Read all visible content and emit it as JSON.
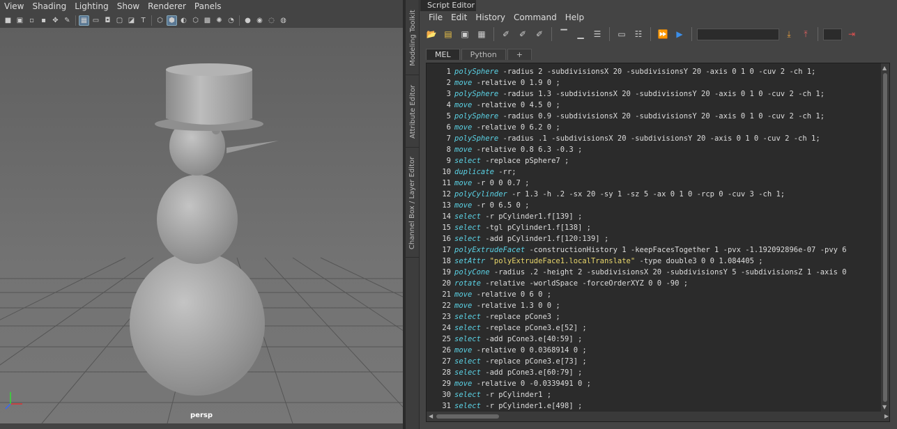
{
  "viewport": {
    "menus": [
      "View",
      "Shading",
      "Lighting",
      "Show",
      "Renderer",
      "Panels"
    ],
    "camera": "persp"
  },
  "side_tabs": [
    "Modeling Toolkit",
    "Attribute Editor",
    "Channel Box / Layer Editor"
  ],
  "script_editor": {
    "title": "Script Editor",
    "menus": [
      "File",
      "Edit",
      "History",
      "Command",
      "Help"
    ],
    "tabs": [
      "MEL",
      "Python",
      "+"
    ],
    "active_tab": "MEL",
    "lines": [
      [
        [
          "kw",
          "polySphere"
        ],
        [
          "t",
          " -radius 2 -subdivisionsX 20 -subdivisionsY 20 -axis 0 1 0 -cuv 2 -ch 1;"
        ]
      ],
      [
        [
          "kw",
          "move"
        ],
        [
          "t",
          " -relative 0 1.9 0 ;"
        ]
      ],
      [
        [
          "kw",
          "polySphere"
        ],
        [
          "t",
          " -radius 1.3 -subdivisionsX 20 -subdivisionsY 20 -axis 0 1 0 -cuv 2 -ch 1;"
        ]
      ],
      [
        [
          "kw",
          "move"
        ],
        [
          "t",
          " -relative 0 4.5 0 ;"
        ]
      ],
      [
        [
          "kw",
          "polySphere"
        ],
        [
          "t",
          " -radius 0.9 -subdivisionsX 20 -subdivisionsY 20 -axis 0 1 0 -cuv 2 -ch 1;"
        ]
      ],
      [
        [
          "kw",
          "move"
        ],
        [
          "t",
          " -relative 0 6.2 0 ;"
        ]
      ],
      [
        [
          "kw",
          "polySphere"
        ],
        [
          "t",
          " -radius .1 -subdivisionsX 20 -subdivisionsY 20 -axis 0 1 0 -cuv 2 -ch 1;"
        ]
      ],
      [
        [
          "kw",
          "move"
        ],
        [
          "t",
          " -relative 0.8 6.3 -0.3 ;"
        ]
      ],
      [
        [
          "kw",
          "select"
        ],
        [
          "t",
          " -replace pSphere7 ;"
        ]
      ],
      [
        [
          "kw",
          "duplicate"
        ],
        [
          "t",
          " -rr;"
        ]
      ],
      [
        [
          "kw",
          "move"
        ],
        [
          "t",
          " -r 0 0 0.7 ;"
        ]
      ],
      [
        [
          "kw",
          "polyCylinder"
        ],
        [
          "t",
          " -r 1.3 -h .2 -sx 20 -sy 1 -sz 5 -ax 0 1 0 -rcp 0 -cuv 3 -ch 1;"
        ]
      ],
      [
        [
          "kw",
          "move"
        ],
        [
          "t",
          " -r 0 6.5 0 ;"
        ]
      ],
      [
        [
          "kw",
          "select"
        ],
        [
          "t",
          " -r pCylinder1.f[139] ;"
        ]
      ],
      [
        [
          "kw",
          "select"
        ],
        [
          "t",
          " -tgl pCylinder1.f[138] ;"
        ]
      ],
      [
        [
          "kw",
          "select"
        ],
        [
          "t",
          " -add pCylinder1.f[120:139] ;"
        ]
      ],
      [
        [
          "kw",
          "polyExtrudeFacet"
        ],
        [
          "t",
          " -constructionHistory 1 -keepFacesTogether 1 -pvx -1.192092896e-07 -pvy 6"
        ]
      ],
      [
        [
          "kw",
          "setAttr"
        ],
        [
          "t",
          " "
        ],
        [
          "str",
          "\"polyExtrudeFace1.localTranslate\""
        ],
        [
          "t",
          " -type double3 0 0 1.084405 ;"
        ]
      ],
      [
        [
          "kw",
          "polyCone"
        ],
        [
          "t",
          " -radius .2 -height 2 -subdivisionsX 20 -subdivisionsY 5 -subdivisionsZ 1 -axis 0"
        ]
      ],
      [
        [
          "kw",
          "rotate"
        ],
        [
          "t",
          " -relative -worldSpace -forceOrderXYZ 0 0 -90 ;"
        ]
      ],
      [
        [
          "kw",
          "move"
        ],
        [
          "t",
          " -relative 0 6 0 ;"
        ]
      ],
      [
        [
          "kw",
          "move"
        ],
        [
          "t",
          " -relative 1.3 0 0 ;"
        ]
      ],
      [
        [
          "kw",
          "select"
        ],
        [
          "t",
          " -replace pCone3 ;"
        ]
      ],
      [
        [
          "kw",
          "select"
        ],
        [
          "t",
          " -replace pCone3.e[52] ;"
        ]
      ],
      [
        [
          "kw",
          "select"
        ],
        [
          "t",
          " -add pCone3.e[40:59] ;"
        ]
      ],
      [
        [
          "kw",
          "move"
        ],
        [
          "t",
          " -relative 0 0.0368914 0 ;"
        ]
      ],
      [
        [
          "kw",
          "select"
        ],
        [
          "t",
          " -replace pCone3.e[73] ;"
        ]
      ],
      [
        [
          "kw",
          "select"
        ],
        [
          "t",
          " -add pCone3.e[60:79] ;"
        ]
      ],
      [
        [
          "kw",
          "move"
        ],
        [
          "t",
          " -relative 0 -0.0339491 0 ;"
        ]
      ],
      [
        [
          "kw",
          "select"
        ],
        [
          "t",
          " -r pCylinder1 ;"
        ]
      ],
      [
        [
          "kw",
          "select"
        ],
        [
          "t",
          " -r pCylinder1.e[498] ;"
        ]
      ]
    ]
  },
  "icons": {
    "viewport_toolbar": [
      "camera-icon",
      "camera-attr-icon",
      "bookmark-icon",
      "image-plane-icon",
      "grid-icon",
      "film-gate-icon",
      "resolution-gate-icon",
      "gate-mask-icon",
      "field-chart-icon",
      "safe-action-icon",
      "safe-title-icon",
      "wireframe-icon",
      "smooth-shade-icon",
      "default-material-icon",
      "textured-icon",
      "use-all-lights-icon",
      "shadows-icon",
      "ambient-occlusion-icon",
      "motion-blur-icon",
      "isolate-select-icon",
      "xray-icon",
      "xray-joints-icon"
    ],
    "script_toolbar": [
      "open-script-icon",
      "source-script-icon",
      "save-script-icon",
      "save-to-shelf-icon",
      "clear-history-icon",
      "clear-input-icon",
      "clear-all-icon",
      "show-history-icon",
      "show-input-icon",
      "show-both-icon",
      "echo-commands-icon",
      "line-numbers-icon",
      "execute-all-icon",
      "execute-icon",
      "search-icon",
      "goto-line-icon"
    ]
  }
}
